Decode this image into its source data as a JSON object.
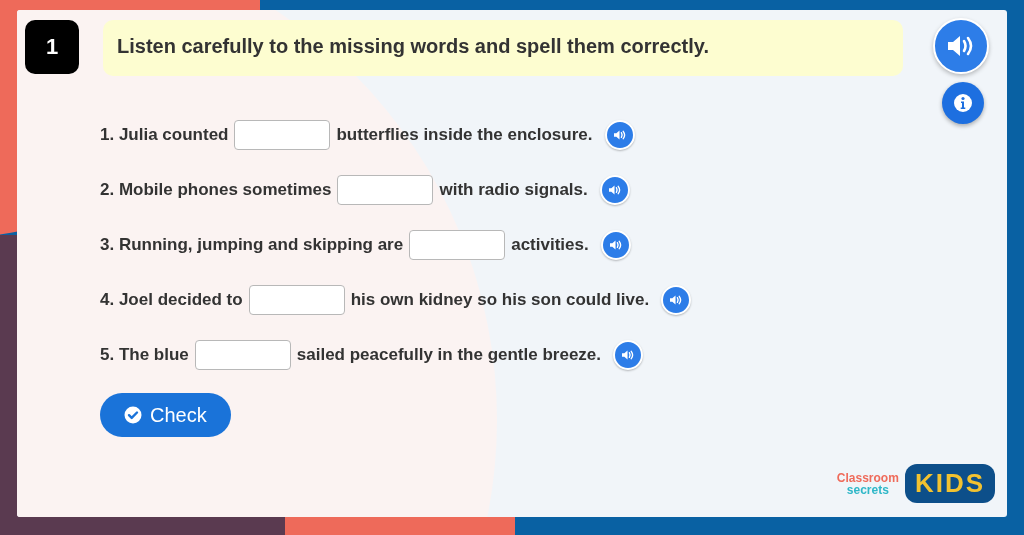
{
  "question_number": "1",
  "instruction": "Listen carefully to the missing words and spell them correctly.",
  "questions": [
    {
      "before": "1. Julia counted",
      "after": "butterflies inside the enclosure."
    },
    {
      "before": "2. Mobile phones sometimes",
      "after": "with radio signals."
    },
    {
      "before": "3. Running, jumping and skipping are",
      "after": "activities."
    },
    {
      "before": "4. Joel decided to",
      "after": "his own kidney so his son could live."
    },
    {
      "before": "5. The blue",
      "after": "sailed peacefully in the gentle breeze."
    }
  ],
  "check_button": "Check",
  "logo": {
    "line_1": "Classroom",
    "line_2": "secrets",
    "badge": "KIDS"
  }
}
